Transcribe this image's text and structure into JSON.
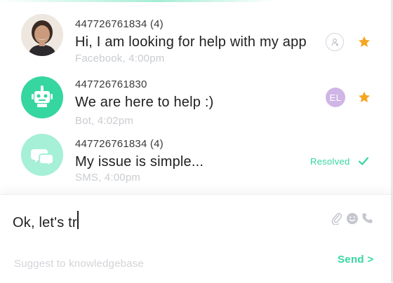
{
  "messages": [
    {
      "sender_id": "447726761834 (4)",
      "text": "Hi, I am looking for help with my app",
      "source": "Facebook, 4:00pm",
      "avatar": "user-photo",
      "starred": true
    },
    {
      "sender_id": "447726761830",
      "text": "We are here to help :)",
      "source": "Bot, 4:02pm",
      "avatar": "robot-icon",
      "agent_initials": "EL",
      "starred": true
    },
    {
      "sender_id": "447726761834 (4)",
      "text": "My issue is simple...",
      "source": "SMS, 4:00pm",
      "avatar": "chat-bubbles-icon",
      "status": "Resolved"
    }
  ],
  "composer": {
    "value": "Ok, let's tr",
    "icons": [
      "paperclip-icon",
      "emoji-icon",
      "phone-icon"
    ],
    "suggest_label": "Suggest to knowledgebase",
    "send_label": "Send >"
  },
  "colors": {
    "accent": "#36d6a0",
    "star": "#f5a623",
    "agent_badge": "#cfb6e6",
    "muted_text": "#c9ccd0"
  }
}
